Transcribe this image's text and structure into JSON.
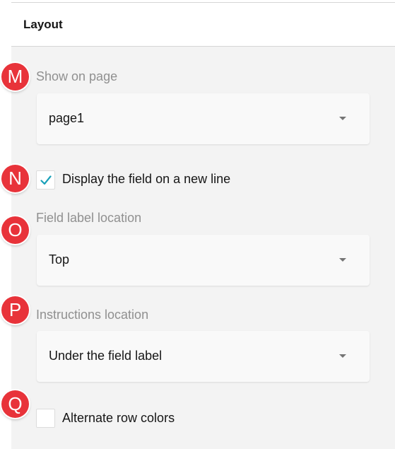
{
  "header": {
    "title": "Layout"
  },
  "fields": {
    "show_on_page": {
      "badge": "M",
      "label": "Show on page",
      "value": "page1"
    },
    "new_line": {
      "badge": "N",
      "label": "Display the field on a new line",
      "checked": true
    },
    "label_location": {
      "badge": "O",
      "label": "Field label location",
      "value": "Top"
    },
    "instructions_location": {
      "badge": "P",
      "label": "Instructions location",
      "value": "Under the field label"
    },
    "alternate_rows": {
      "badge": "Q",
      "label": "Alternate row colors",
      "checked": false
    }
  },
  "colors": {
    "badge": "#e8333a",
    "checkmark": "#19a0b8",
    "panel_bg": "#f3f3f3"
  }
}
